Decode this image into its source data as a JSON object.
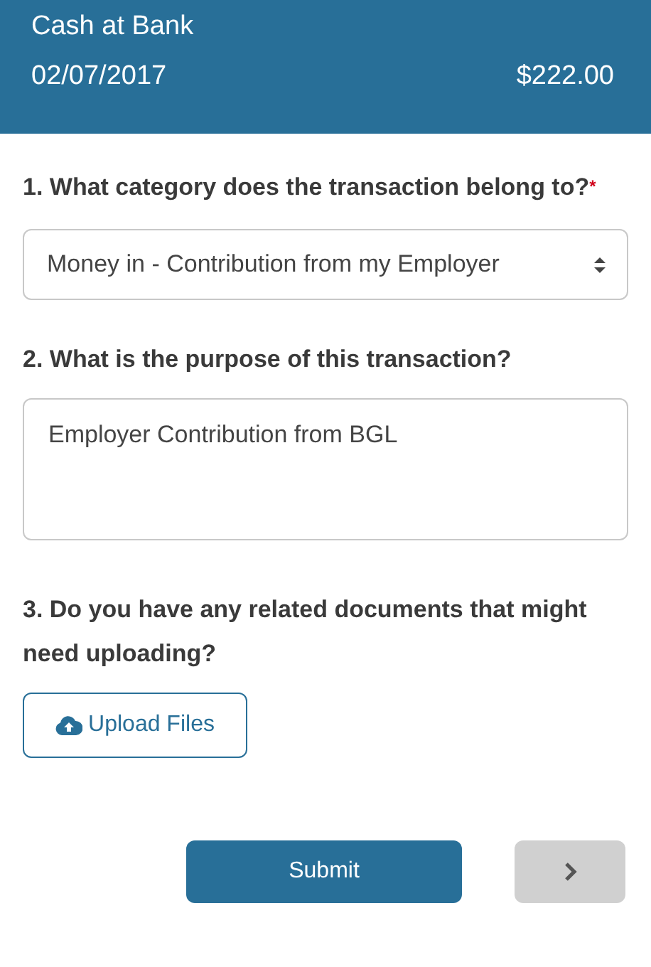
{
  "header": {
    "title": "Cash at Bank",
    "date": "02/07/2017",
    "amount": "$222.00"
  },
  "questions": [
    {
      "kind": "select",
      "label": "1. What category does the transaction belong to?",
      "required_mark": "*",
      "value": "Money in - Contribution from my Employer"
    },
    {
      "kind": "textarea",
      "label": "2. What is the purpose of this transaction?",
      "value": "Employer Contribution from BGL"
    },
    {
      "kind": "upload",
      "label": "3. Do you have any related documents that might need uploading?",
      "button": "Upload Files"
    }
  ],
  "actions": {
    "submit": "Submit",
    "next": {
      "disabled": true
    }
  }
}
